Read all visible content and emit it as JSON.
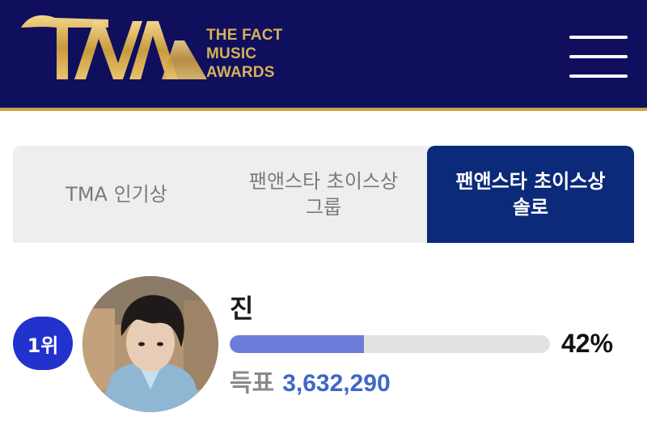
{
  "header": {
    "logo_mark": "TMA",
    "logo_lines": [
      "THE FACT",
      "MUSIC",
      "AWARDS"
    ],
    "menu_icon": "hamburger-icon"
  },
  "tabs": [
    {
      "lines": [
        "TMA 인기상"
      ],
      "active": false
    },
    {
      "lines": [
        "팬앤스타 초이스상",
        "그룹"
      ],
      "active": false
    },
    {
      "lines": [
        "팬앤스타 초이스상",
        "솔로"
      ],
      "active": true
    }
  ],
  "entry": {
    "rank": "1위",
    "name": "진",
    "percent_label": "42%",
    "percent_value": 42,
    "votes_label": "득표",
    "votes": "3,632,290"
  },
  "colors": {
    "header_bg": "#0f0f5e",
    "gold": "#d7b157",
    "active_tab": "#0c2a7a",
    "badge": "#2232cc",
    "bar_fill": "#6d7dda",
    "votes_number": "#3f66c8"
  }
}
